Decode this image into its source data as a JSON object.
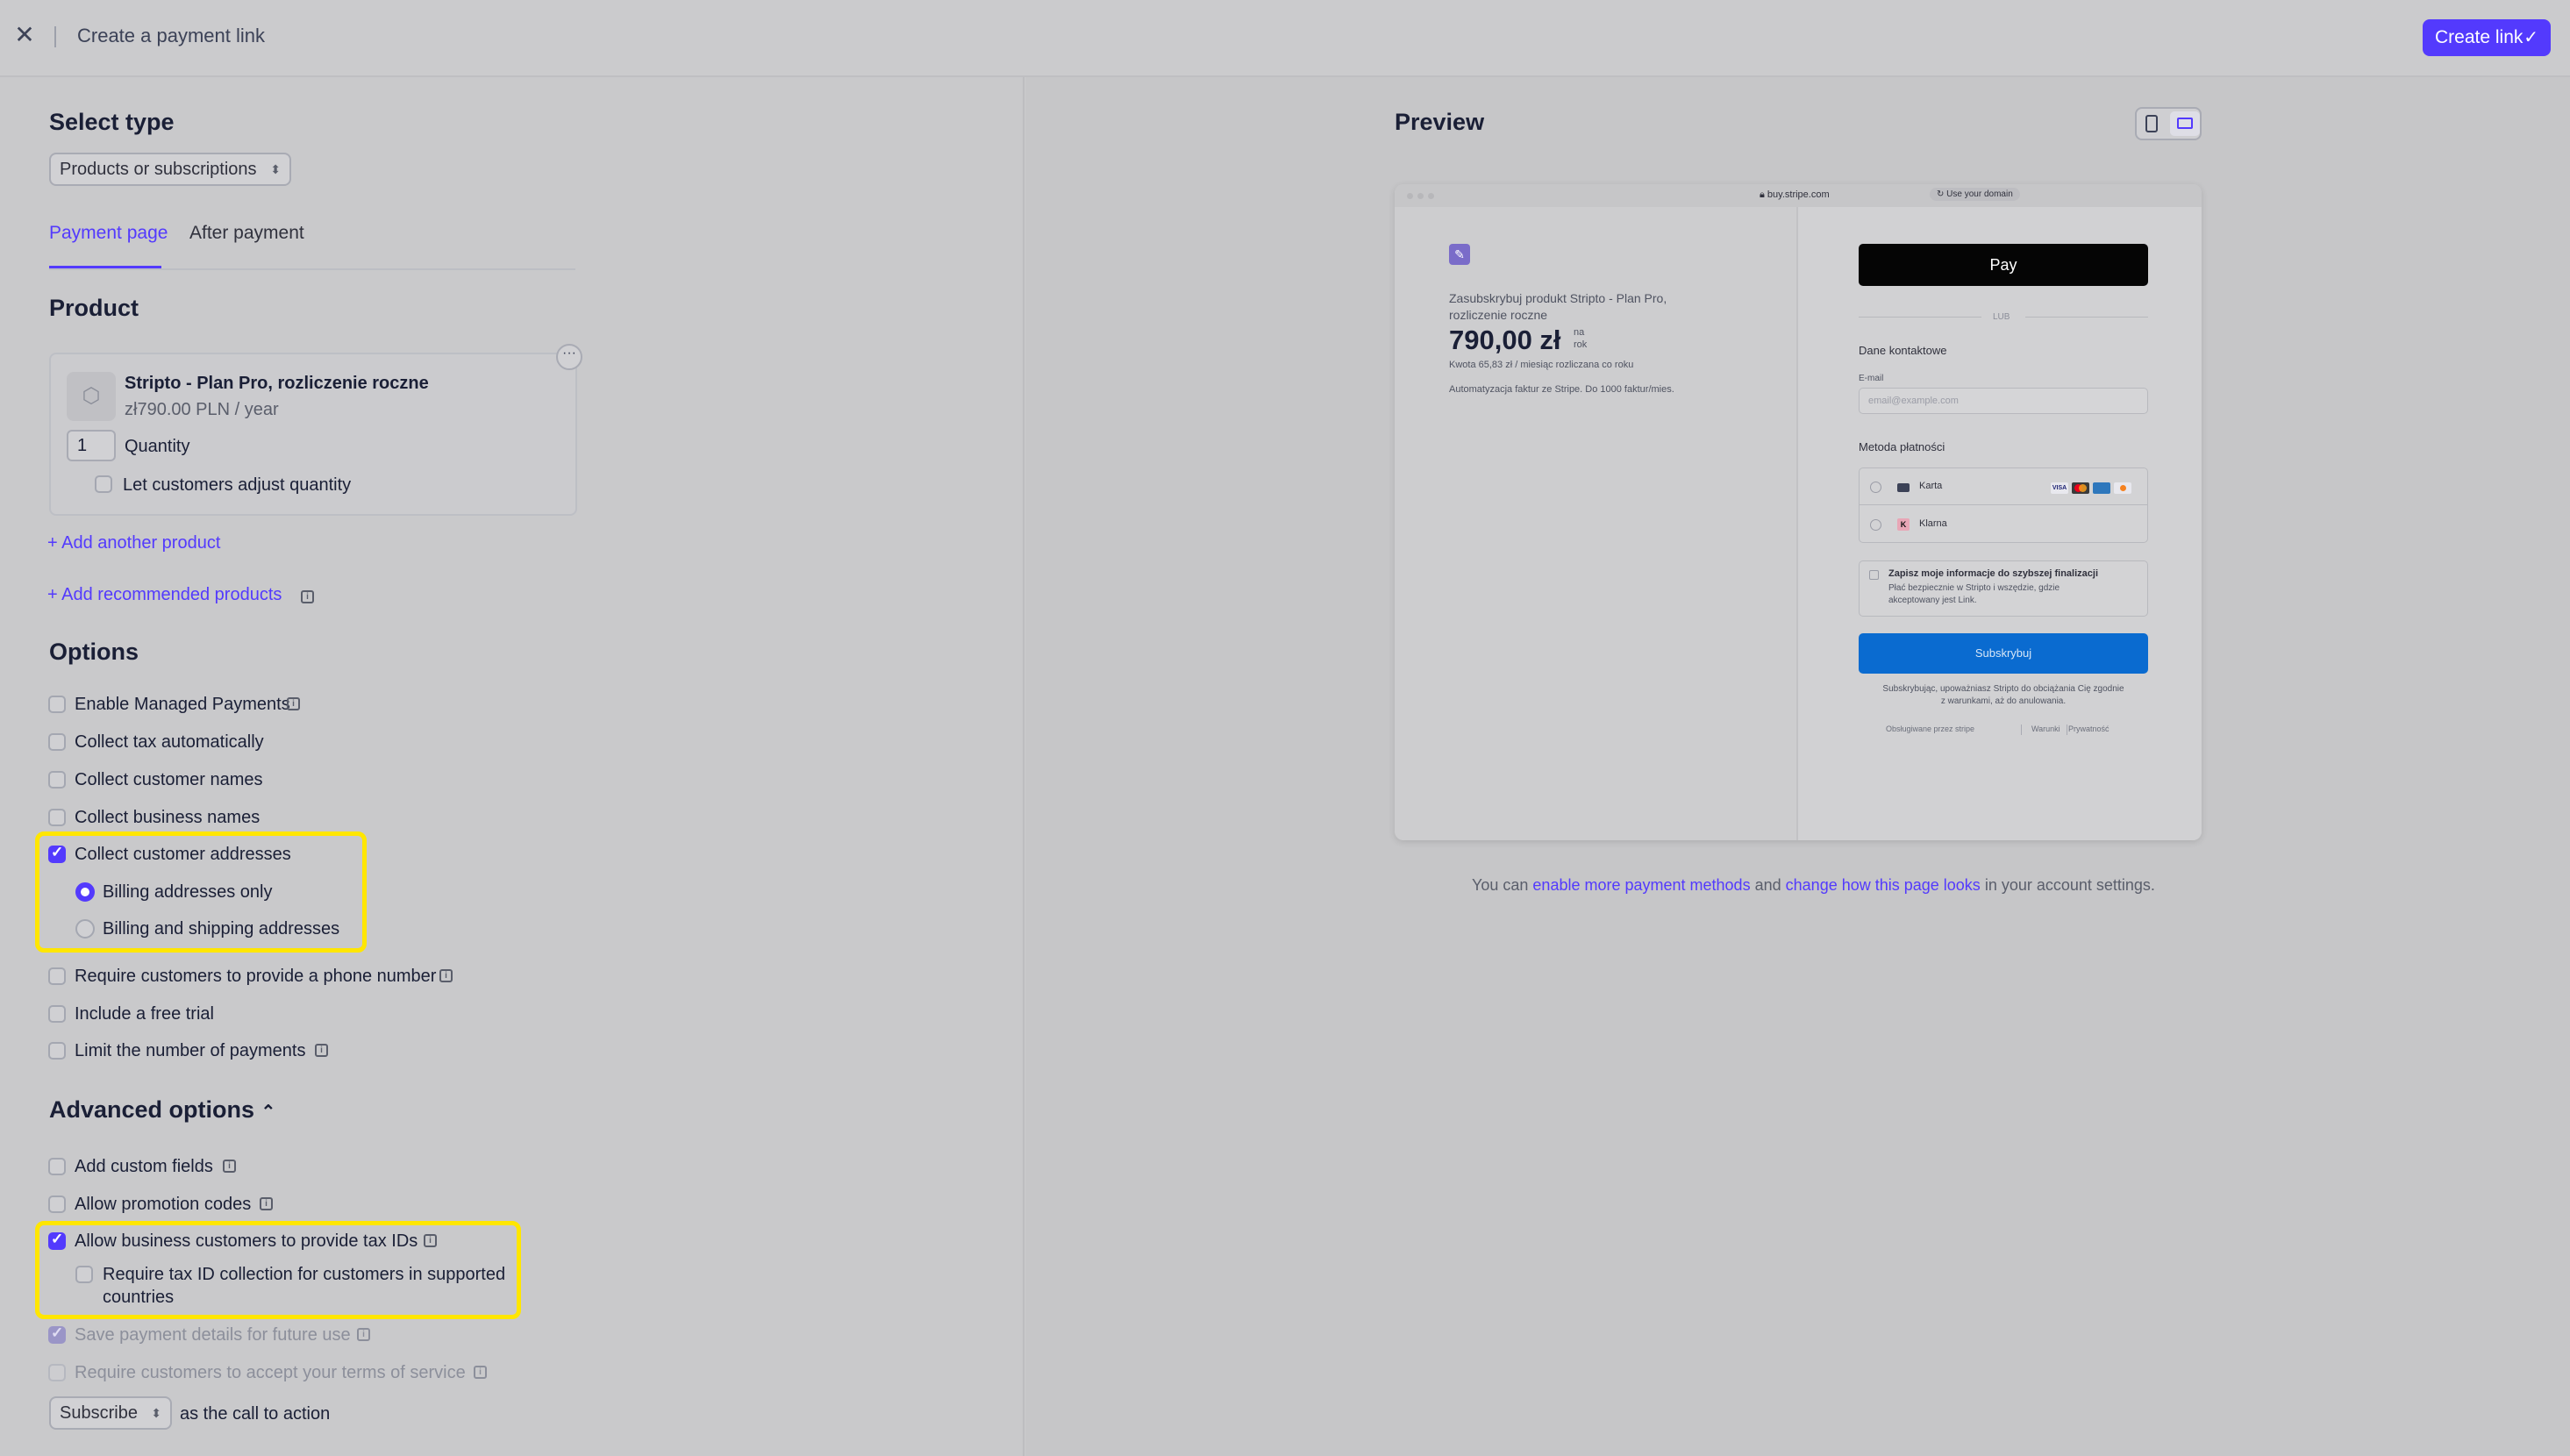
{
  "header": {
    "title": "Create a payment link",
    "create_label": "Create link"
  },
  "left": {
    "select_type": {
      "heading": "Select type",
      "value": "Products or subscriptions"
    },
    "tabs": [
      {
        "label": "Payment page",
        "active": true
      },
      {
        "label": "After payment",
        "active": false
      }
    ],
    "product": {
      "heading": "Product",
      "name": "Stripto - Plan Pro, rozliczenie roczne",
      "price": "zł790.00 PLN / year",
      "quantity_value": "1",
      "quantity_label": "Quantity",
      "adjust_label": "Let customers adjust quantity",
      "add_another": "Add another product",
      "add_recommended": "Add recommended products"
    },
    "options": {
      "heading": "Options",
      "items": [
        {
          "label": "Enable Managed Payments",
          "checked": false
        },
        {
          "label": "Collect tax automatically",
          "checked": false
        },
        {
          "label": "Collect customer names",
          "checked": false
        },
        {
          "label": "Collect business names",
          "checked": false
        },
        {
          "label": "Collect customer addresses",
          "checked": true
        },
        {
          "label": "Require customers to provide a phone number",
          "checked": false
        },
        {
          "label": "Include a free trial",
          "checked": false
        },
        {
          "label": "Limit the number of payments",
          "checked": false
        }
      ],
      "address_radios": [
        {
          "label": "Billing addresses only",
          "selected": true
        },
        {
          "label": "Billing and shipping addresses",
          "selected": false
        }
      ]
    },
    "advanced": {
      "heading": "Advanced options",
      "items": [
        {
          "label": "Add custom fields",
          "checked": false
        },
        {
          "label": "Allow promotion codes",
          "checked": false
        },
        {
          "label": "Allow business customers to provide tax IDs",
          "checked": true
        },
        {
          "label": "Save payment details for future use",
          "checked": true,
          "disabled": true
        },
        {
          "label": "Require customers to accept your terms of service",
          "checked": false,
          "disabled": true
        }
      ],
      "require_tax_line1": "Require tax ID collection for customers in supported",
      "require_tax_line2": "countries",
      "cta_value": "Subscribe",
      "cta_suffix": "as the call to action"
    }
  },
  "preview": {
    "heading": "Preview",
    "url": "buy.stripe.com",
    "use_domain": "Use your domain",
    "product_line1": "Zasubskrybuj produkt Stripto - Plan Pro,",
    "product_line2": "rozliczenie roczne",
    "price": "790,00 zł",
    "per_na": "na",
    "per_rok": "rok",
    "monthly": "Kwota 65,83 zł / miesiąc rozliczana co roku",
    "description": "Automatyzacja faktur ze Stripe. Do 1000 faktur/mies.",
    "apple_pay": "Pay",
    "lub": "LUB",
    "contact_heading": "Dane kontaktowe",
    "email_label": "E-mail",
    "email_placeholder": "email@example.com",
    "payment_method_heading": "Metoda płatności",
    "method_card": "Karta",
    "method_klarna": "Klarna",
    "save_info_title": "Zapisz moje informacje do szybszej finalizacji",
    "save_info_line1": "Płać bezpiecznie w Stripto i wszędzie, gdzie",
    "save_info_line2": "akceptowany jest Link.",
    "subscribe_btn": "Subskrybuj",
    "terms_line1": "Subskrybując, upoważniasz Stripto do obciążania Cię zgodnie",
    "terms_line2": "z warunkami, aż do anulowania.",
    "powered": "Obsługiwane przez stripe",
    "terms_link": "Warunki",
    "privacy_link": "Prywatność",
    "footer_prefix": "You can",
    "footer_link1": "enable more payment methods",
    "footer_and": "and",
    "footer_link2": "change how this page looks",
    "footer_suffix": "in your account settings."
  },
  "colors": {
    "accent": "#533afd",
    "highlight": "#ffe600",
    "stripe_blue": "#0570de"
  }
}
